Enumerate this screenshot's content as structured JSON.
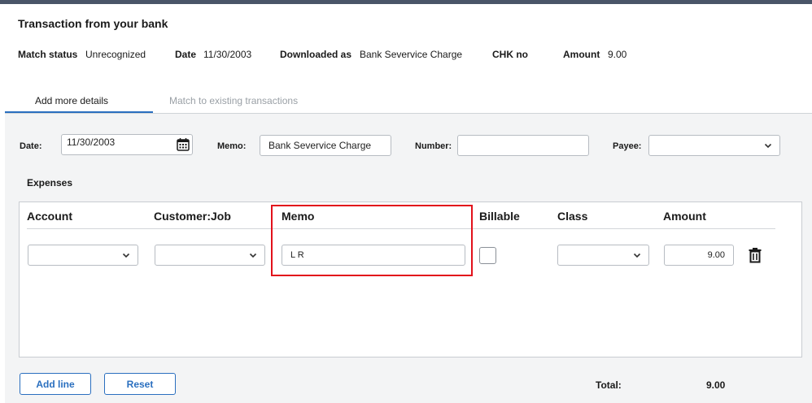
{
  "header": {
    "title": "Transaction from your bank",
    "match_status_label": "Match status",
    "match_status_value": "Unrecognized",
    "date_label": "Date",
    "date_value": "11/30/2003",
    "downloaded_label": "Downloaded as",
    "downloaded_value": "Bank Severvice Charge",
    "chk_label": "CHK no",
    "amount_label": "Amount",
    "amount_value": "9.00"
  },
  "tabs": [
    {
      "label": "Add more details",
      "active": true
    },
    {
      "label": "Match to existing transactions",
      "active": false
    }
  ],
  "form": {
    "date_label": "Date:",
    "date_value": "11/30/2003",
    "memo_label": "Memo:",
    "memo_value": "Bank Severvice Charge",
    "number_label": "Number:",
    "number_value": "",
    "payee_label": "Payee:",
    "payee_value": ""
  },
  "expenses": {
    "title": "Expenses",
    "columns": [
      "Account",
      "Customer:Job",
      "Memo",
      "Billable",
      "Class",
      "Amount"
    ],
    "rows": [
      {
        "account": "",
        "customer_job": "",
        "memo": "L R",
        "billable": false,
        "class": "",
        "amount": "9.00"
      }
    ]
  },
  "footer": {
    "add_line_label": "Add line",
    "reset_label": "Reset",
    "total_label": "Total:",
    "total_value": "9.00"
  },
  "colors": {
    "accent": "#2a6fbf",
    "highlight": "#e2111b",
    "panel_bg": "#f3f4f5"
  },
  "icons": [
    "calendar-icon",
    "chevron-down-icon",
    "trash-icon"
  ]
}
